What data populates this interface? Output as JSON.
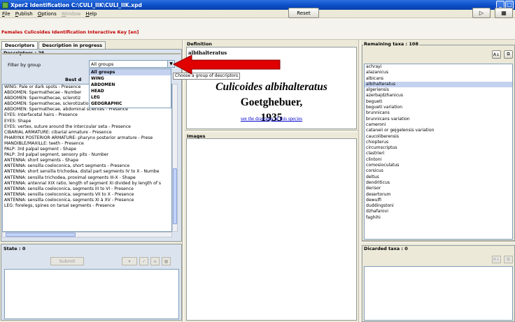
{
  "window": {
    "title": "Xper2 Identification   C:\\CULI_IIK\\CULI_IIK.xpd",
    "minimize": "_",
    "maximize": "□"
  },
  "menu": {
    "file": "File",
    "publish": "Publish",
    "options": "Options",
    "window": "Window",
    "help": "Help"
  },
  "header": {
    "key_title": "Females Culicoides Identification Interactive Key [en]",
    "reset_label": "Reset",
    "tool1": "▷",
    "tool2": "▦"
  },
  "descriptors": {
    "tabs": [
      "Descriptors",
      "Description in progress"
    ],
    "group_title": "Descriptors : 25",
    "filter_label": "Filter by group",
    "filter_value": "All groups",
    "best_label": "Best d",
    "items": [
      "WING: Pale or dark spots - Presence",
      "ABDOMEN: Spermathecae - Number",
      "ABDOMEN: Spermathecae, sclerotiz",
      "ABDOMEN: Spermathecae, sclerotization - Degree",
      "ABDOMEN: Spermathecae, abdominal sclerites - Presence",
      "EYES: Interfacetal hairs - Presence",
      "EYES: Shape",
      "EYES: vertex, suture around the intercoular seta - Presence",
      "CIBARIAL ARMATURE: cibarial armature - Presence",
      "PHARYNX POSTERIOR ARMATURE: pharynx posterior armature - Prese",
      "MANDIBLE/MAXILLE: teeth - Presence",
      "PALP: 3rd palpal segment - Shape",
      "PALP: 3rd palpal segment, sensory pits - Number",
      "ANTENNA: short segments - Shape",
      "ANTENNA: sensilla coeloconica, short segments - Presence",
      "ANTENNA: short sensilla trichodea, distal part segments IV to X - Numbe",
      "ANTENNA: sensilla trichodea, proximal segments III-X - Shape",
      "ANTENNA: antennal XIX ratio, length of segment XI divided by length of s",
      "ANTENNA: sensilla coeloconica, segments III to VI - Presence",
      "ANTENNA: sensilla coeloconica, segments VII to X - Presence",
      "ANTENNA: sensilla coeloconica, segments XI à XV - Presence",
      "LEG: forelegs, spines on tarsal segments - Presence"
    ],
    "dropdown_options": [
      "All groups",
      "WING",
      "ABDOMEN",
      "HEAD",
      "LEG",
      "GEOGRAPHIC"
    ],
    "tooltip": "Choose a group of descriptors"
  },
  "state": {
    "title": "State : 0",
    "submit_label": "Submit"
  },
  "definition": {
    "title": "Definition",
    "taxon_short": "albihalteratus",
    "taxon_italic": "Culicoides albihalteratus",
    "taxon_author": "Goetghebuer,",
    "year": "1935",
    "drawings_link": "see the drawings of this species"
  },
  "images": {
    "title": "Images"
  },
  "remaining": {
    "title": "Remaining taxa : 108",
    "selected_index": 3,
    "items": [
      "achrayi",
      "alazanicus",
      "albicans",
      "albihalteratus",
      "algeriensis",
      "azerbajdzhanicus",
      "begueti",
      "begueti variation",
      "brunnicans",
      "brunnicans variation",
      "cameroni",
      "cataneii or gejgelensis variation",
      "caucoliberensis",
      "chiopterus",
      "circumscriptus",
      "clastrieri",
      "clintoni",
      "comosioculatus",
      "corsicus",
      "deltus",
      "dendriticus",
      "derisor",
      "desertorum",
      "dewulfi",
      "duddingstoni",
      "dzhafarovi",
      "faghihi"
    ]
  },
  "discarded": {
    "title": "Dicarded taxa : 0"
  },
  "colors": {
    "title_red": "#c00000",
    "link_blue": "#0000cc",
    "arrow_red": "#e00000",
    "selection": "#c4d2f0"
  }
}
